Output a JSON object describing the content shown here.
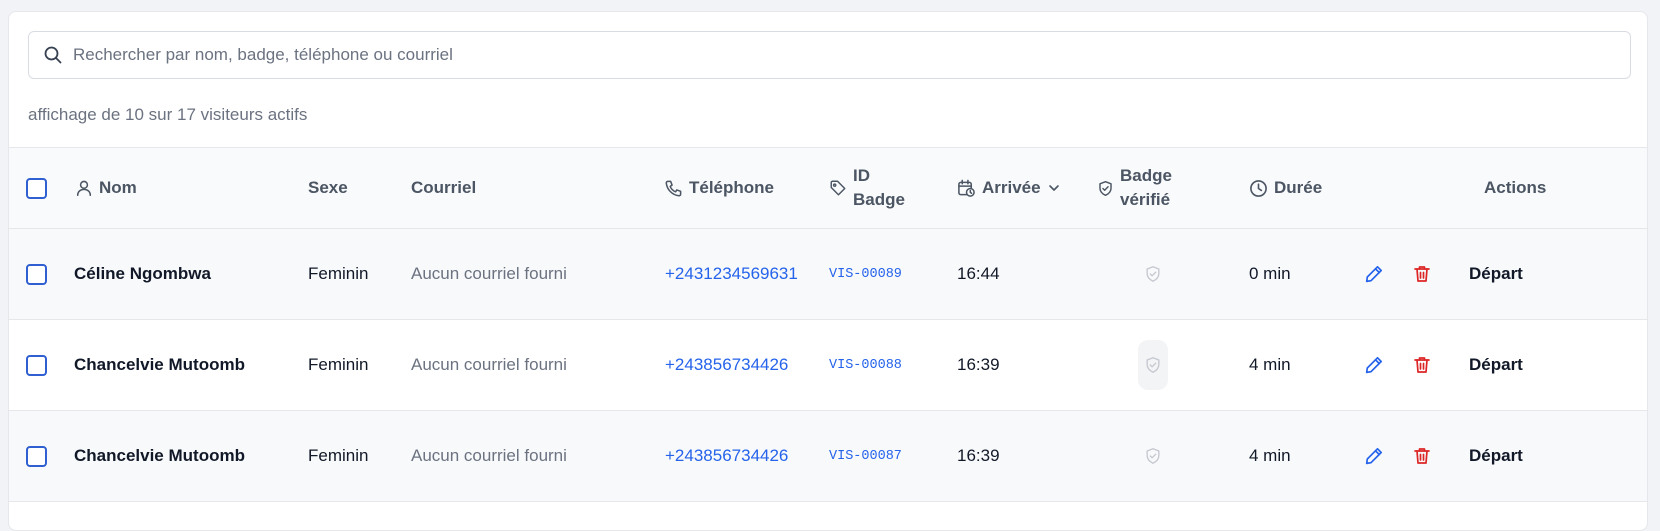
{
  "search": {
    "placeholder": "Rechercher par nom, badge, téléphone ou courriel",
    "value": ""
  },
  "summary_text": "affichage de 10 sur 17 visiteurs actifs",
  "headers": {
    "name": "Nom",
    "sex": "Sexe",
    "email": "Courriel",
    "phone": "Téléphone",
    "badge_line1": "ID",
    "badge_line2": "Badge",
    "arrival": "Arrivée",
    "verified_line1": "Badge",
    "verified_line2": "vérifié",
    "duration": "Durée",
    "actions": "Actions"
  },
  "rows": [
    {
      "name": "Céline Ngombwa",
      "sex": "Feminin",
      "email": "Aucun courriel fourni",
      "phone": "+2431234569631",
      "badge": "VIS-00089",
      "arrival": "16:44",
      "duration": "0 min",
      "depart_label": "Départ"
    },
    {
      "name": "Chancelvie Mutoomb",
      "sex": "Feminin",
      "email": "Aucun courriel fourni",
      "phone": "+243856734426",
      "badge": "VIS-00088",
      "arrival": "16:39",
      "duration": "4 min",
      "depart_label": "Départ"
    },
    {
      "name": "Chancelvie Mutoomb",
      "sex": "Feminin",
      "email": "Aucun courriel fourni",
      "phone": "+243856734426",
      "badge": "VIS-00087",
      "arrival": "16:39",
      "duration": "4 min",
      "depart_label": "Départ"
    }
  ],
  "colors": {
    "accent": "#2563eb",
    "checkbox_border": "#2f5fd0",
    "delete": "#dc2626",
    "muted_text": "#6b7280"
  },
  "icons": [
    "search-icon",
    "user-icon",
    "phone-icon",
    "tag-icon",
    "calendar-clock-icon",
    "chevron-down-icon",
    "shield-check-icon",
    "clock-icon",
    "pencil-icon",
    "trash-icon"
  ]
}
